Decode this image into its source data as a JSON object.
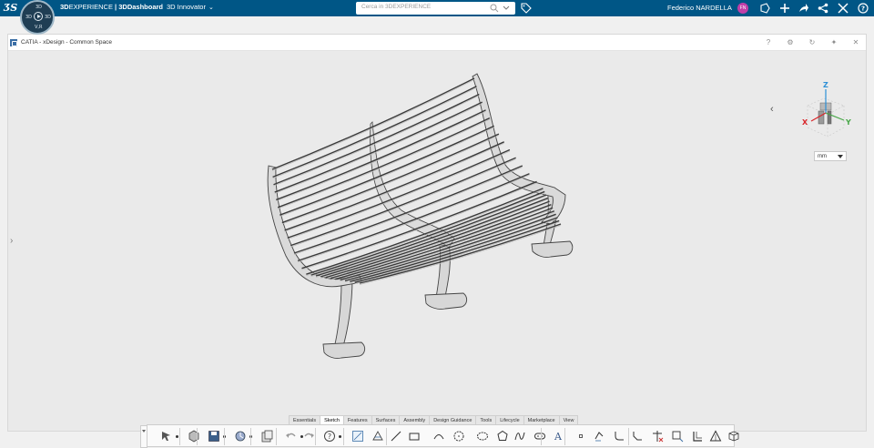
{
  "topbar": {
    "ds_logo": "ƷS",
    "compass": {
      "north": "3D",
      "west": "3D",
      "east": "3D",
      "south": "V,R"
    },
    "brand_prefix": "3D",
    "brand_experience": "EXPERIENCE",
    "brand_sep": " | 3D",
    "brand_dashboard": "Dashboard",
    "role": "3D Innovator",
    "search_placeholder": "Cerca in 3DEXPERIENCE",
    "user_name": "Federico NARDELLA",
    "avatar_initials": "FN",
    "icons": [
      "share-icon",
      "add-icon",
      "forward-icon",
      "network-icon",
      "tools-icon",
      "help-icon"
    ]
  },
  "widget": {
    "title": "CATIA - xDesign - Common Space",
    "buttons": [
      "?",
      "⚙",
      "↻",
      "✦",
      "✕"
    ]
  },
  "viewport": {
    "units": "mm",
    "axes": {
      "x": "X",
      "y": "Y",
      "z": "Z"
    },
    "colors": {
      "x": "#d9262b",
      "y": "#4aa84a",
      "z": "#2c8fd6"
    }
  },
  "tabs": [
    {
      "label": "Essentials",
      "active": false
    },
    {
      "label": "Sketch",
      "active": true
    },
    {
      "label": "Features",
      "active": false
    },
    {
      "label": "Surfaces",
      "active": false
    },
    {
      "label": "Assembly",
      "active": false
    },
    {
      "label": "Design Guidance",
      "active": false
    },
    {
      "label": "Tools",
      "active": false
    },
    {
      "label": "Lifecycle",
      "active": false
    },
    {
      "label": "Marketplace",
      "active": false
    },
    {
      "label": "View",
      "active": false
    }
  ],
  "toolbar_icons": [
    "select-icon",
    "part-icon",
    "save-icon",
    "update-icon",
    "clipboard-icon",
    "undo-icon",
    "redo-icon",
    "help-icon",
    "sketch-icon",
    "sketch-on-plane-icon",
    "line-icon",
    "rectangle-icon",
    "arc-icon",
    "circle-icon",
    "ellipse-icon",
    "polygon-icon",
    "spline-icon",
    "slot-icon",
    "text-icon",
    "point-icon",
    "offset-icon",
    "fillet-icon",
    "chamfer-icon",
    "trim-icon",
    "project-icon",
    "convert-icon",
    "triangle-icon",
    "3d-box-icon"
  ]
}
